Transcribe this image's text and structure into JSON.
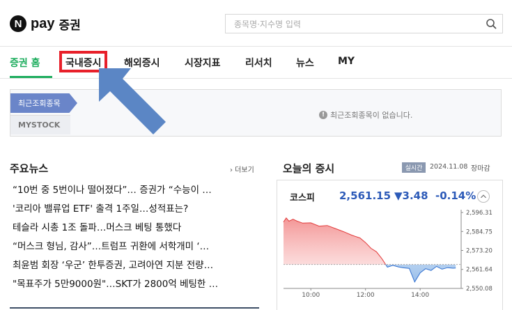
{
  "header": {
    "logo_n": "N",
    "logo_pay": "pay",
    "logo_sec": "증권",
    "search_placeholder": "종목명·지수명 입력",
    "search_icon": "search-icon"
  },
  "nav": {
    "items": [
      {
        "label": "증권 홈",
        "active": true
      },
      {
        "label": "국내증시",
        "highlighted": true
      },
      {
        "label": "해외증시"
      },
      {
        "label": "시장지표"
      },
      {
        "label": "리서치"
      },
      {
        "label": "뉴스"
      },
      {
        "label": "MY"
      }
    ],
    "active_color": "#1bac5c",
    "highlight_color": "#e8202a"
  },
  "annotation": {
    "arrow_icon": "arrow-pointer-icon",
    "arrow_color": "#5b86c5"
  },
  "recent": {
    "tab_label": "최근조회종목",
    "mystock_label": "MYSTOCK",
    "empty_message": "최근조회종목이 없습니다."
  },
  "news": {
    "title": "주요뉴스",
    "more": "› 더보기",
    "items": [
      "“10번 중 5번이나 떨어졌다”… 증권가 “수능이 …",
      "'코리아 밸류업 ETF' 출격 1주일…성적표는?",
      "테슬라 시총 1조 돌파…머스크 베팅 통했다",
      "“머스크 형님, 감사”…트럼프 귀환에 서학개미 ‘…",
      "최윤범 회장 ‘우군’ 한투증권, 고려아연 지분 전량…",
      "\"목표주가 5만9000원\"…SKT가 2800억 베팅한 …"
    ]
  },
  "market": {
    "title": "오늘의 증시",
    "realtime_badge": "실시간",
    "date": "2024.11.08",
    "status": "장마감",
    "index_name": "코스피",
    "value": "2,561.15",
    "change": "▼3.48",
    "rate": "-0.14%",
    "down_color": "#2c5ab8",
    "up_color": "#e23b3b"
  },
  "chart_data": {
    "type": "area",
    "x_ticks": [
      "10:00",
      "12:00",
      "14:00"
    ],
    "y_ticks": [
      "2,596.31",
      "2,584.75",
      "2,573.20",
      "2,561.64",
      "2,550.08"
    ],
    "ylim": [
      2550.08,
      2596.31
    ],
    "baseline": 2564.63,
    "x": [
      9.0,
      9.1,
      9.2,
      9.35,
      9.5,
      9.7,
      10.0,
      10.3,
      10.6,
      10.9,
      11.2,
      11.5,
      11.8,
      12.0,
      12.2,
      12.4,
      12.6,
      12.8,
      13.0,
      13.2,
      13.4,
      13.6,
      13.8,
      14.0,
      14.2,
      14.4,
      14.6,
      14.8,
      15.0,
      15.2,
      15.3
    ],
    "values": [
      2590.5,
      2593.0,
      2591.0,
      2592.2,
      2591.0,
      2589.8,
      2590.0,
      2588.0,
      2588.4,
      2586.5,
      2584.6,
      2582.5,
      2580.8,
      2578.0,
      2574.5,
      2572.4,
      2568.2,
      2563.0,
      2564.1,
      2563.2,
      2562.6,
      2562.3,
      2554.0,
      2559.6,
      2562.1,
      2561.0,
      2563.5,
      2561.8,
      2562.7,
      2562.4,
      2562.5
    ]
  }
}
